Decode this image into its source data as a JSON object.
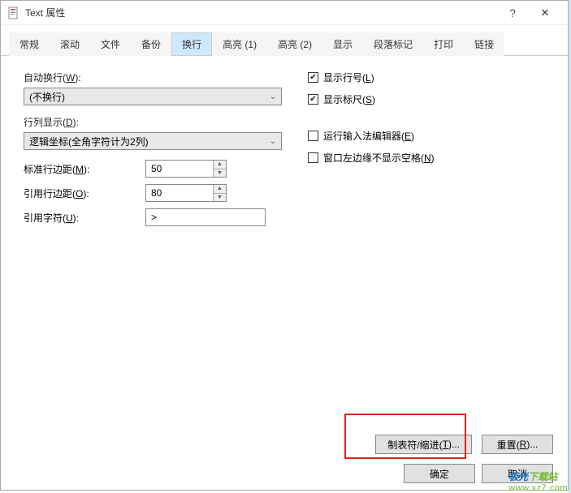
{
  "window": {
    "title": "Text 属性",
    "help_symbol": "?",
    "close_symbol": "✕"
  },
  "tabs": [
    {
      "label": "常规"
    },
    {
      "label": "滚动"
    },
    {
      "label": "文件"
    },
    {
      "label": "备份"
    },
    {
      "label": "换行"
    },
    {
      "label": "高亮 (1)"
    },
    {
      "label": "高亮 (2)"
    },
    {
      "label": "显示"
    },
    {
      "label": "段落标记"
    },
    {
      "label": "打印"
    },
    {
      "label": "链接"
    }
  ],
  "active_tab_index": 4,
  "left": {
    "auto_wrap_label_pre": "自动换行(",
    "auto_wrap_label_u": "W",
    "auto_wrap_label_post": "):",
    "auto_wrap_value": "(不换行)",
    "line_col_label_pre": "行列显示(",
    "line_col_label_u": "D",
    "line_col_label_post": "):",
    "line_col_value": "逻辑坐标(全角字符计为2列)",
    "std_margin_label_pre": "标准行边距(",
    "std_margin_label_u": "M",
    "std_margin_label_post": "):",
    "std_margin_value": "50",
    "quote_margin_label_pre": "引用行边距(",
    "quote_margin_label_u": "O",
    "quote_margin_label_post": "):",
    "quote_margin_value": "80",
    "quote_char_label_pre": "引用字符(",
    "quote_char_label_u": "U",
    "quote_char_label_post": "):",
    "quote_char_value": ">"
  },
  "right": {
    "show_lineno_pre": "显示行号(",
    "show_lineno_u": "L",
    "show_lineno_post": ")",
    "show_lineno_checked": true,
    "show_ruler_pre": "显示标尺(",
    "show_ruler_u": "S",
    "show_ruler_post": ")",
    "show_ruler_checked": true,
    "ime_pre": "运行输入法编辑器(",
    "ime_u": "E",
    "ime_post": ")",
    "ime_checked": false,
    "noblank_pre": "窗口左边缘不显示空格(",
    "noblank_u": "N",
    "noblank_post": ")",
    "noblank_checked": false
  },
  "buttons": {
    "tab_indent_pre": "制表符/缩进(",
    "tab_indent_u": "T",
    "tab_indent_post": ")...",
    "reset_pre": "重置(",
    "reset_u": "R",
    "reset_post": ")...",
    "ok": "确定",
    "cancel": "取消"
  },
  "watermark": {
    "line1": "极光下载站",
    "line2": "www.xz7.com"
  },
  "glyphs": {
    "chevron_down": "⌄",
    "arrow_up": "▲",
    "arrow_down": "▼",
    "check": "✔"
  }
}
